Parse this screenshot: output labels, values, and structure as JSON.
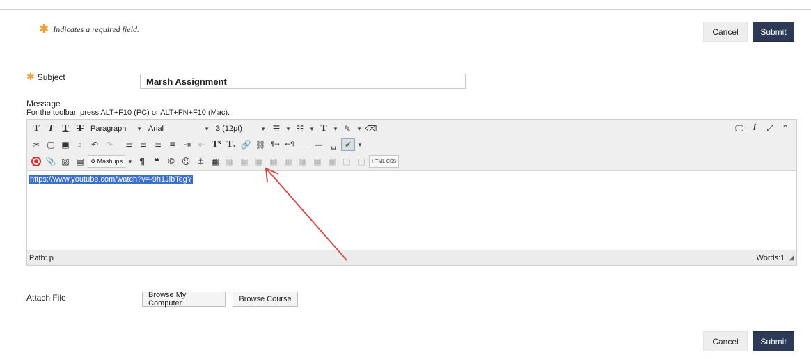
{
  "form": {
    "required_note": "Indicates a required field.",
    "cancel_label": "Cancel",
    "submit_label": "Submit"
  },
  "subject": {
    "label": "Subject",
    "value": "Marsh Assignment"
  },
  "message": {
    "label": "Message",
    "help": "For the toolbar, press ALT+F10 (PC) or ALT+FN+F10 (Mac).",
    "content_link": "https://www.youtube.com/watch?v=-9h1JibTegY"
  },
  "toolbar": {
    "format_dropdown": "Paragraph",
    "font_dropdown": "Arial",
    "size_dropdown": "3 (12pt)",
    "mashups_label": "Mashups",
    "html_css_label": "HTML CSS"
  },
  "statusbar": {
    "path": "Path: p",
    "words": "Words:1"
  },
  "attach": {
    "label": "Attach File",
    "browse_computer": "Browse My Computer",
    "browse_course": "Browse Course"
  },
  "colors": {
    "submit_bg": "#2d3a55",
    "required_star": "#f0a030",
    "selection": "#3a6fcc",
    "annotation_arrow": "#d0504a"
  },
  "icons": [
    "bold-icon",
    "italic-icon",
    "underline-icon",
    "strikethrough-icon",
    "cut-icon",
    "copy-icon",
    "paste-icon",
    "find-icon",
    "undo-icon",
    "redo-icon",
    "align-left-icon",
    "align-center-icon",
    "align-right-icon",
    "justify-icon",
    "indent-icon",
    "outdent-icon",
    "superscript-icon",
    "subscript-icon",
    "insert-link-icon",
    "unlink-icon",
    "ltr-icon",
    "rtl-icon",
    "horizontal-rule-icon",
    "nonbreaking-space-icon",
    "spellcheck-icon",
    "youtube-icon",
    "attachment-icon",
    "image-icon",
    "media-icon",
    "pilcrow-icon",
    "blockquote-icon",
    "copyright-icon",
    "emoticon-icon",
    "anchor-icon",
    "table-icon",
    "preview-icon",
    "info-icon",
    "fullscreen-icon",
    "collapse-icon"
  ]
}
